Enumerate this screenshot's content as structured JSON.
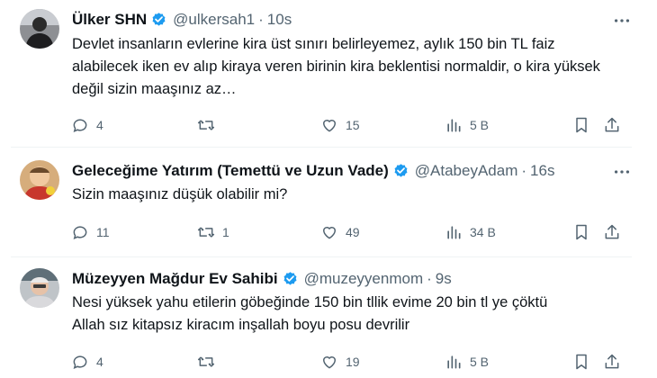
{
  "tweets": [
    {
      "name": "Ülker SHN",
      "handle": "@ulkersah1",
      "separator": "·",
      "time": "10s",
      "text": "Devlet insanların evlerine kira üst sınırı belirleyemez, aylık 150 bin TL faiz alabilecek iken ev alıp kiraya veren birinin kira beklentisi normaldir, o kira yüksek değil sizin maaşınız az…",
      "replies": "4",
      "retweets": "",
      "likes": "15",
      "views": "5 B"
    },
    {
      "name": "Geleceğime Yatırım (Temettü ve Uzun Vade)",
      "handle": "@AtabeyAdam",
      "separator": "·",
      "time": "16s",
      "text": "Sizin maaşınız düşük olabilir mi?",
      "replies": "11",
      "retweets": "1",
      "likes": "49",
      "views": "34 B"
    },
    {
      "name": "Müzeyyen Mağdur Ev Sahibi",
      "handle": "@muzeyyenmom",
      "separator": "·",
      "time": "9s",
      "text_lines": [
        "Nesi yüksek yahu etilerin göbeğinde 150 bin tllik evime 20 bin tl ye çöktü",
        "Allah sız kitapsız kiracım inşallah boyu posu devrilir"
      ],
      "replies": "4",
      "retweets": "",
      "likes": "19",
      "views": "5 B"
    }
  ],
  "colors": {
    "text": "#0f1419",
    "secondary": "#536471",
    "verified": "#1d9bf0",
    "divider": "#eff3f4"
  },
  "icons": [
    "verified-badge-icon",
    "more-icon",
    "reply-icon",
    "retweet-icon",
    "like-icon",
    "views-icon",
    "bookmark-icon",
    "share-icon"
  ]
}
